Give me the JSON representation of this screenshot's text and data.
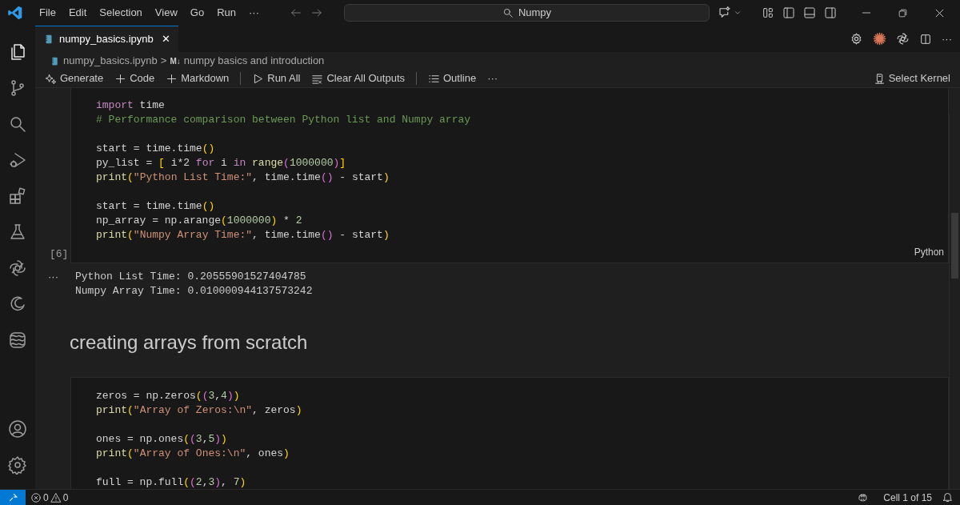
{
  "title_bar": {
    "menu": [
      "File",
      "Edit",
      "Selection",
      "View",
      "Go",
      "Run",
      "···"
    ],
    "search": {
      "value": "Numpy"
    }
  },
  "tabs": [
    {
      "label": "numpy_basics.ipynb",
      "selected": true,
      "close": "✕"
    }
  ],
  "tab_actions": {
    "more": "···"
  },
  "breadcrumb": {
    "file": "numpy_basics.ipynb",
    "separator": ">",
    "section_icon": "M↓",
    "section": "numpy basics and introduction"
  },
  "toolbar": {
    "generate": "Generate",
    "code": "Code",
    "markdown": "Markdown",
    "run_all": "Run All",
    "clear": "Clear All Outputs",
    "outline": "Outline",
    "more": "···",
    "kernel": "Select Kernel"
  },
  "cells": [
    {
      "kind": "code",
      "count": "[6]",
      "language": "Python",
      "lines": [
        {
          "kind": "code",
          "tokens": [
            {
              "kind": "kw",
              "text": "import"
            },
            {
              "kind": "p",
              "text": " time"
            }
          ]
        },
        {
          "kind": "code",
          "tokens": [
            {
              "kind": "cm",
              "text": "# Performance comparison between Python list and Numpy array"
            }
          ]
        },
        {
          "kind": "blank"
        },
        {
          "kind": "code",
          "tokens": [
            {
              "kind": "p",
              "text": "start = time.time"
            },
            {
              "kind": "b1",
              "text": "()"
            }
          ]
        },
        {
          "kind": "code",
          "tokens": [
            {
              "kind": "p",
              "text": "py_list = "
            },
            {
              "kind": "b1",
              "text": "["
            },
            {
              "kind": "p",
              "text": " i*2 "
            },
            {
              "kind": "kw",
              "text": "for"
            },
            {
              "kind": "p",
              "text": " i "
            },
            {
              "kind": "kw",
              "text": "in"
            },
            {
              "kind": "fn",
              "text": " range"
            },
            {
              "kind": "b2",
              "text": "("
            },
            {
              "kind": "num",
              "text": "1000000"
            },
            {
              "kind": "b2",
              "text": ")"
            },
            {
              "kind": "b1",
              "text": "]"
            }
          ]
        },
        {
          "kind": "code",
          "tokens": [
            {
              "kind": "fn",
              "text": "print"
            },
            {
              "kind": "b1",
              "text": "("
            },
            {
              "kind": "str",
              "text": "\"Python List Time:\""
            },
            {
              "kind": "p",
              "text": ", time.time"
            },
            {
              "kind": "b2",
              "text": "()"
            },
            {
              "kind": "p",
              "text": " - start"
            },
            {
              "kind": "b1",
              "text": ")"
            }
          ]
        },
        {
          "kind": "blank"
        },
        {
          "kind": "code",
          "tokens": [
            {
              "kind": "p",
              "text": "start = time.time"
            },
            {
              "kind": "b1",
              "text": "()"
            }
          ]
        },
        {
          "kind": "code",
          "tokens": [
            {
              "kind": "p",
              "text": "np_array = np.arange"
            },
            {
              "kind": "b1",
              "text": "("
            },
            {
              "kind": "num",
              "text": "1000000"
            },
            {
              "kind": "b1",
              "text": ")"
            },
            {
              "kind": "p",
              "text": " * "
            },
            {
              "kind": "num",
              "text": "2"
            }
          ]
        },
        {
          "kind": "code",
          "tokens": [
            {
              "kind": "fn",
              "text": "print"
            },
            {
              "kind": "b1",
              "text": "("
            },
            {
              "kind": "str",
              "text": "\"Numpy Array Time:\""
            },
            {
              "kind": "p",
              "text": ", time.time"
            },
            {
              "kind": "b2",
              "text": "()"
            },
            {
              "kind": "p",
              "text": " - start"
            },
            {
              "kind": "b1",
              "text": ")"
            }
          ]
        }
      ],
      "output": {
        "marker": "···",
        "lines": [
          "Python List Time: 0.20555901527404785",
          "Numpy Array Time: 0.010000944137573242"
        ]
      }
    },
    {
      "kind": "markdown",
      "heading": "creating arrays from scratch"
    },
    {
      "kind": "code",
      "lines": [
        {
          "kind": "code",
          "tokens": [
            {
              "kind": "p",
              "text": "zeros = np.zeros"
            },
            {
              "kind": "b1",
              "text": "("
            },
            {
              "kind": "b2",
              "text": "("
            },
            {
              "kind": "num",
              "text": "3"
            },
            {
              "kind": "p",
              "text": ","
            },
            {
              "kind": "num",
              "text": "4"
            },
            {
              "kind": "b2",
              "text": ")"
            },
            {
              "kind": "b1",
              "text": ")"
            }
          ]
        },
        {
          "kind": "code",
          "tokens": [
            {
              "kind": "fn",
              "text": "print"
            },
            {
              "kind": "b1",
              "text": "("
            },
            {
              "kind": "str",
              "text": "\"Array of Zeros:\\n\""
            },
            {
              "kind": "p",
              "text": ", zeros"
            },
            {
              "kind": "b1",
              "text": ")"
            }
          ]
        },
        {
          "kind": "blank"
        },
        {
          "kind": "code",
          "tokens": [
            {
              "kind": "p",
              "text": "ones = np.ones"
            },
            {
              "kind": "b1",
              "text": "("
            },
            {
              "kind": "b2",
              "text": "("
            },
            {
              "kind": "num",
              "text": "3"
            },
            {
              "kind": "p",
              "text": ","
            },
            {
              "kind": "num",
              "text": "5"
            },
            {
              "kind": "b2",
              "text": ")"
            },
            {
              "kind": "b1",
              "text": ")"
            }
          ]
        },
        {
          "kind": "code",
          "tokens": [
            {
              "kind": "fn",
              "text": "print"
            },
            {
              "kind": "b1",
              "text": "("
            },
            {
              "kind": "str",
              "text": "\"Array of Ones:\\n\""
            },
            {
              "kind": "p",
              "text": ", ones"
            },
            {
              "kind": "b1",
              "text": ")"
            }
          ]
        },
        {
          "kind": "blank"
        },
        {
          "kind": "code",
          "tokens": [
            {
              "kind": "p",
              "text": "full = np.full"
            },
            {
              "kind": "b1",
              "text": "("
            },
            {
              "kind": "b2",
              "text": "("
            },
            {
              "kind": "num",
              "text": "2"
            },
            {
              "kind": "p",
              "text": ","
            },
            {
              "kind": "num",
              "text": "3"
            },
            {
              "kind": "b2",
              "text": ")"
            },
            {
              "kind": "p",
              "text": ", "
            },
            {
              "kind": "num",
              "text": "7"
            },
            {
              "kind": "b1",
              "text": ")"
            }
          ]
        }
      ]
    }
  ],
  "status_bar": {
    "errors": "0",
    "warnings": "0",
    "cell": "Cell 1 of 15"
  }
}
